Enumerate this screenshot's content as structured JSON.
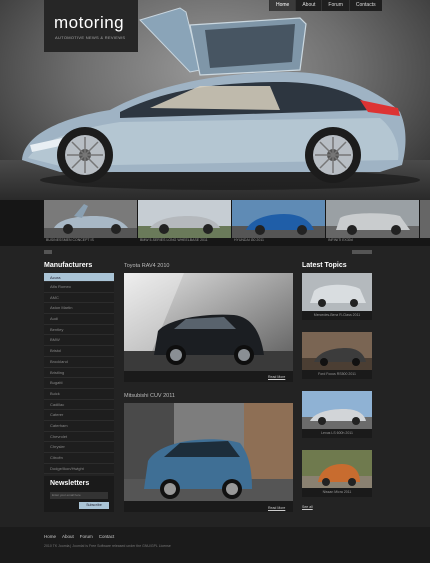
{
  "brand": {
    "name": "motoring",
    "tagline": "AUTOMOTIVE NEWS & REVIEWS"
  },
  "topnav": [
    {
      "label": "Home",
      "active": true
    },
    {
      "label": "About",
      "active": false
    },
    {
      "label": "Forum",
      "active": false
    },
    {
      "label": "Contacts",
      "active": false
    }
  ],
  "strip": {
    "captions": [
      "BUSINESSMEN CONCEPT IS",
      "BMW 5-SERIES LONG WHEELBASE 2011",
      "HYUNDAI i30 2011",
      "INFINITI EX30d"
    ]
  },
  "sidebar": {
    "title": "Manufacturers",
    "items": [
      "Acura",
      "Alfa Romeo",
      "AMC",
      "Aston Martin",
      "Audi",
      "Bentley",
      "BMW",
      "Bristol",
      "Brockland",
      "Bristling",
      "Bugatti",
      "Buick",
      "Cadillac",
      "Caterer",
      "Caterham",
      "Chevrolet",
      "Chrysler",
      "Citroën",
      "Dodge/Ikon/Hwight"
    ]
  },
  "newsletter": {
    "title": "Newsletters",
    "placeholder": "Enter your email here",
    "button": "Subscribe"
  },
  "articles": [
    {
      "title": "Toyota RAV4 2010",
      "more": "Read More"
    },
    {
      "title": "Mitsubishi CUV 2011",
      "more": "Read More"
    }
  ],
  "latest": {
    "title": "Latest Topics",
    "items": [
      "Mercedes-Benz R-Class 2011",
      "Ford Focus RS500 2011",
      "Lexus LS 600h 2011",
      "Nissan Micra 2011"
    ],
    "see_all": "See all"
  },
  "footer": {
    "links": [
      "Home",
      "About",
      "Forum",
      "Contact"
    ],
    "copyright": "2010 TK Joomla | Joomla! is Free Software released under the GNU/GPL License"
  },
  "colors": {
    "accent": "#aac4d6",
    "background": "#232323"
  }
}
